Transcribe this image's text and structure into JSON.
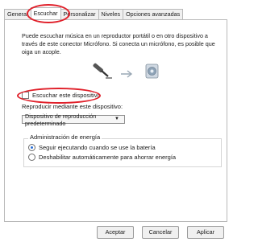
{
  "tabs": [
    "General",
    "Escuchar",
    "Personalizar",
    "Niveles",
    "Opciones avanzadas"
  ],
  "description": "Puede escuchar música en un reproductor portátil o en otro dispositivo a través de este conector Micrófono. Si conecta un micrófono, es posible que oiga un acople.",
  "listen_checkbox": {
    "label": "Escuchar este dispositivo",
    "checked": false
  },
  "playback": {
    "label": "Reproducir mediante este dispositivo:",
    "selected": "Dispositivo de reproducción predeterminado"
  },
  "power": {
    "title": "Administración de energía",
    "options": [
      {
        "label": "Seguir ejecutando cuando se use la batería",
        "checked": true
      },
      {
        "label": "Deshabilitar automáticamente para ahorrar energía",
        "checked": false
      }
    ]
  },
  "buttons": {
    "ok": "Aceptar",
    "cancel": "Cancelar",
    "apply": "Aplicar"
  },
  "colors": {
    "highlight": "#e0202a",
    "accent": "#2a6fd6"
  }
}
